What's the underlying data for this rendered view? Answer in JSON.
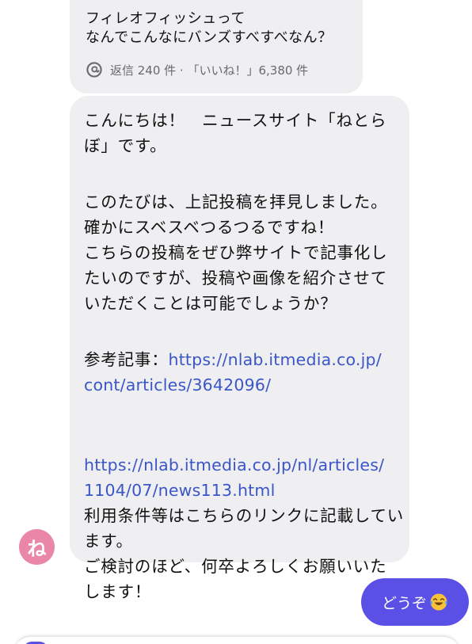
{
  "shared_post": {
    "line1": "フィレオフィッシュって",
    "line2": "なんでこんなにバンズすべすべなん？",
    "meta": "返信 240 件 · 「いいね！」6,380 件",
    "icon": "threads-icon"
  },
  "message": {
    "lines_1": [
      "こんにちは！　ニュースサイト「ねとら",
      "ぼ」です。"
    ],
    "lines_2": [
      "このたびは、上記投稿を拝見しました。",
      "確かにスベスベつるつるですね！",
      "こちらの投稿をぜひ弊サイトで記事化し",
      "たいのですが、投稿や画像を紹介させて",
      "いただくことは可能でしょうか？"
    ],
    "ref_label": "参考記事：",
    "ref_link_part1": "https://nlab.itmedia.co.jp/",
    "ref_link_part2": "cont/articles/3642096/",
    "terms_link_part1": "https://nlab.itmedia.co.jp/nl/articles/",
    "terms_link_part2": "1104/07/news113.html",
    "lines_3": [
      "利用条件等はこちらのリンクに記載してい",
      "ます。",
      "ご検討のほど、何卒よろしくお願いいた",
      "します！"
    ]
  },
  "avatar": {
    "initial": "ね",
    "color": "#ea86a8"
  },
  "reply": {
    "text": "どうぞ",
    "emoji": "face-with-tears-of-joy",
    "color": "#5a50e6"
  },
  "colors": {
    "bubble": "#efeff2",
    "link": "#3a56c6"
  }
}
